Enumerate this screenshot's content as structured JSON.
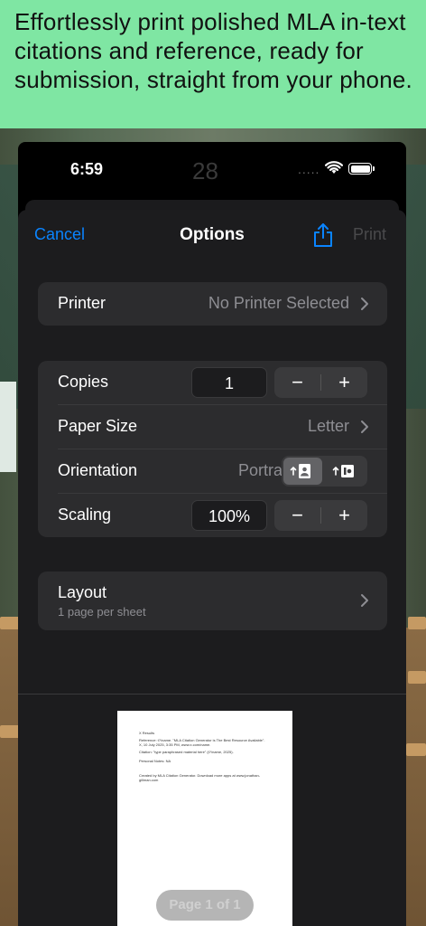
{
  "headline": "Effortlessly print polished MLA in-text citations and reference, ready for submission, straight from your phone.",
  "status": {
    "time": "6:59",
    "ghost": "28",
    "dots": "....."
  },
  "nav": {
    "cancel": "Cancel",
    "title": "Options",
    "print": "Print"
  },
  "printer": {
    "label": "Printer",
    "value": "No Printer Selected"
  },
  "copies": {
    "label": "Copies",
    "value": "1",
    "minus": "−",
    "plus": "+"
  },
  "paper_size": {
    "label": "Paper Size",
    "value": "Letter"
  },
  "orientation": {
    "label": "Orientation",
    "value": "Portrait",
    "options": [
      "portrait-icon",
      "landscape-icon"
    ],
    "selected": "portrait-icon"
  },
  "scaling": {
    "label": "Scaling",
    "value": "100%",
    "minus": "−",
    "plus": "+"
  },
  "layout": {
    "label": "Layout",
    "sub": "1 page per sheet"
  },
  "preview": {
    "title": "X Results",
    "lines": [
      "Reference: t?/name. \"MLA Citation Generator is The Best Resource Available\". X, 10 July 2025, 3:35 PM, www.x.com/name.",
      "Citation: \"type paraphrased material here\" (t?/name, 2025).",
      "Personal Notes: NA",
      "Created by MLA Citation Generator. Download more apps at www.jonathan-gillman.com"
    ],
    "page_indicator": "Page 1 of 1"
  },
  "colors": {
    "accent": "#0a84ff",
    "sheet": "#1c1c1e",
    "group": "#2c2c2e",
    "banner": "#7fe6a3"
  }
}
